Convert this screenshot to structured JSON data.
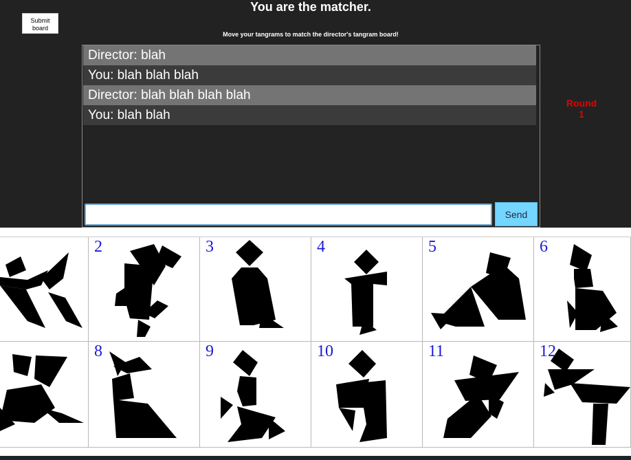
{
  "header": {
    "submit_label": "Submit\nboard",
    "title": "You are the matcher.",
    "subtitle": "Move your tangrams to match the director's tangram board!",
    "round_label": "Round\n1",
    "round_color": "#e30000"
  },
  "chat": {
    "messages": [
      {
        "text": "Director: blah",
        "role": "director"
      },
      {
        "text": "You: blah blah blah",
        "role": "you"
      },
      {
        "text": "Director: blah blah blah blah",
        "role": "director"
      },
      {
        "text": "You: blah blah",
        "role": "you"
      }
    ],
    "input_value": "",
    "send_label": "Send"
  },
  "board": {
    "tiles": [
      {
        "number": "",
        "icon": "tangram-figure-icon"
      },
      {
        "number": "2",
        "icon": "tangram-figure-icon"
      },
      {
        "number": "3",
        "icon": "tangram-figure-icon"
      },
      {
        "number": "4",
        "icon": "tangram-figure-icon"
      },
      {
        "number": "5",
        "icon": "tangram-figure-icon"
      },
      {
        "number": "6",
        "icon": "tangram-figure-icon"
      },
      {
        "number": "",
        "icon": "tangram-figure-icon"
      },
      {
        "number": "8",
        "icon": "tangram-figure-icon"
      },
      {
        "number": "9",
        "icon": "tangram-figure-icon"
      },
      {
        "number": "10",
        "icon": "tangram-figure-icon"
      },
      {
        "number": "11",
        "icon": "tangram-figure-icon"
      },
      {
        "number": "12",
        "icon": "tangram-figure-icon"
      }
    ],
    "number_color": "#1a1ad4"
  }
}
